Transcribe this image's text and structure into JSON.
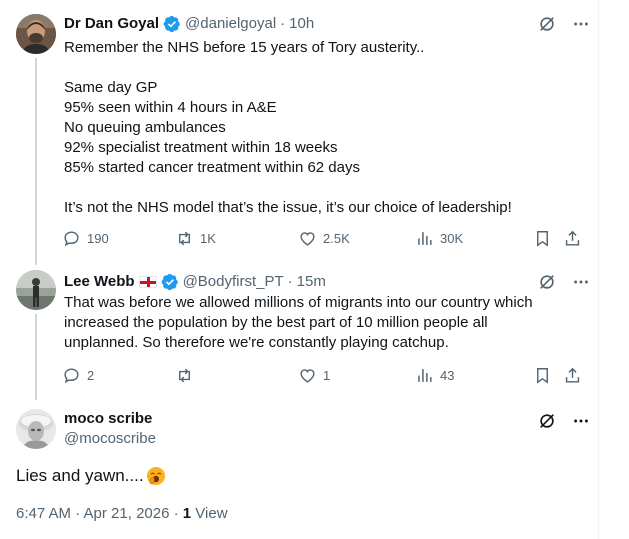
{
  "tweets": [
    {
      "author_name": "Dr Dan Goyal",
      "handle": "@danielgoyal",
      "separator": "·",
      "time": "10h",
      "text": "Remember the NHS before 15 years of Tory austerity..\n\nSame day GP\n95% seen within 4 hours in A&E\nNo queuing ambulances\n92% specialist treatment within 18 weeks\n85% started cancer treatment within 62 days\n\nIt’s not the NHS model that’s the issue, it’s our choice of leadership!",
      "replies": "190",
      "reposts": "1K",
      "likes": "2.5K",
      "views": "30K"
    },
    {
      "author_name": "Lee Webb",
      "handle": "@Bodyfirst_PT",
      "separator": "·",
      "time": "15m",
      "text": "That was before we allowed millions of migrants into our country which\nincreased the population by the best part of 10 million people all\nunplanned. So therefore we're constantly playing catchup.",
      "replies": "2",
      "reposts": "",
      "likes": "1",
      "views": "43"
    }
  ],
  "main_tweet": {
    "author_name": "moco scribe",
    "handle": "@mocoscribe",
    "text": "Lies and yawn....",
    "timestamp": "6:47 AM · Apr 21, 2026 ·",
    "views_count": "1",
    "views_label": "View"
  },
  "icons": [
    "grok-icon",
    "more-icon",
    "reply-icon",
    "repost-icon",
    "like-icon",
    "views-icon",
    "bookmark-icon",
    "share-icon",
    "verified-badge-icon",
    "england-flag-icon",
    "yawning-face-emoji"
  ],
  "colors": {
    "accent": "#1d9bf0",
    "secondary_text": "#536471",
    "primary_text": "#0f1419",
    "thread_line": "#cfd9de"
  }
}
